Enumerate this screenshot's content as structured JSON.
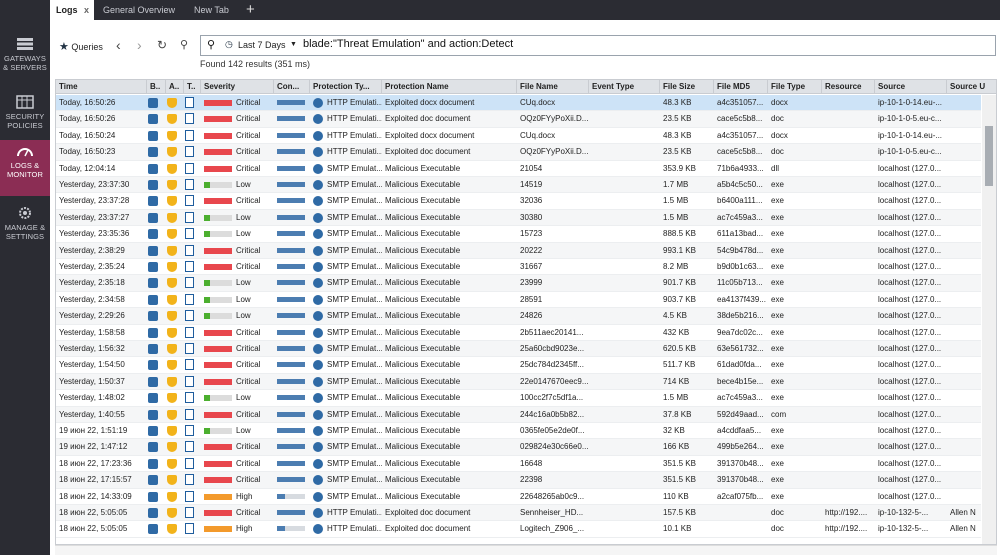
{
  "sidebar": {
    "items": [
      {
        "label_line1": "GATEWAYS",
        "label_line2": "& SERVERS",
        "icon": "gateways-icon",
        "active": false
      },
      {
        "label_line1": "SECURITY",
        "label_line2": "POLICIES",
        "icon": "policies-icon",
        "active": false
      },
      {
        "label_line1": "LOGS &",
        "label_line2": "MONITOR",
        "icon": "monitor-icon",
        "active": true
      },
      {
        "label_line1": "MANAGE &",
        "label_line2": "SETTINGS",
        "icon": "settings-icon",
        "active": false
      }
    ]
  },
  "tabs": {
    "items": [
      "Logs",
      "General Overview",
      "New Tab"
    ],
    "close": "x",
    "plus": "+"
  },
  "toolbar": {
    "queries_label": "Queries",
    "time_filter": "Last 7 Days",
    "query_text": "blade:\"Threat Emulation\" and action:Detect",
    "found_text": "Found 142 results (351 ms)"
  },
  "grid": {
    "columns": [
      "Time",
      "B..",
      "A..",
      "T..",
      "Severity",
      "Con...",
      "Protection Ty...",
      "Protection Name",
      "File Name",
      "Event Type",
      "File Size",
      "File MD5",
      "File Type",
      "Resource",
      "Source",
      "Source U"
    ],
    "rows": [
      [
        "Today, 16:50:26",
        "Critical",
        "HTTP Emulati...",
        "Exploited docx document",
        "CUq.docx",
        "",
        "48.3 KB",
        "a4c351057...",
        "docx",
        "",
        "ip-10-1-0-14.eu-...",
        ""
      ],
      [
        "Today, 16:50:26",
        "Critical",
        "HTTP Emulati...",
        "Exploited doc document",
        "OQz0FYyPoXii.D...",
        "",
        "23.5 KB",
        "cace5c5b8...",
        "doc",
        "",
        "ip-10-1-0-5.eu-c...",
        ""
      ],
      [
        "Today, 16:50:24",
        "Critical",
        "HTTP Emulati...",
        "Exploited docx document",
        "CUq.docx",
        "",
        "48.3 KB",
        "a4c351057...",
        "docx",
        "",
        "ip-10-1-0-14.eu-...",
        ""
      ],
      [
        "Today, 16:50:23",
        "Critical",
        "HTTP Emulati...",
        "Exploited doc document",
        "OQz0FYyPoXii.D...",
        "",
        "23.5 KB",
        "cace5c5b8...",
        "doc",
        "",
        "ip-10-1-0-5.eu-c...",
        ""
      ],
      [
        "Today, 12:04:14",
        "Critical",
        "SMTP Emulat...",
        "Malicious Executable",
        "21054",
        "",
        "353.9 KB",
        "71b6a4933...",
        "dll",
        "",
        "localhost (127.0...",
        ""
      ],
      [
        "Yesterday, 23:37:30",
        "Low",
        "SMTP Emulat...",
        "Malicious Executable",
        "14519",
        "",
        "1.7 MB",
        "a5b4c5c50...",
        "exe",
        "",
        "localhost (127.0...",
        ""
      ],
      [
        "Yesterday, 23:37:28",
        "Critical",
        "SMTP Emulat...",
        "Malicious Executable",
        "32036",
        "",
        "1.5 MB",
        "b6400a111...",
        "exe",
        "",
        "localhost (127.0...",
        ""
      ],
      [
        "Yesterday, 23:37:27",
        "Low",
        "SMTP Emulat...",
        "Malicious Executable",
        "30380",
        "",
        "1.5 MB",
        "ac7c459a3...",
        "exe",
        "",
        "localhost (127.0...",
        ""
      ],
      [
        "Yesterday, 23:35:36",
        "Low",
        "SMTP Emulat...",
        "Malicious Executable",
        "15723",
        "",
        "888.5 KB",
        "611a13bad...",
        "exe",
        "",
        "localhost (127.0...",
        ""
      ],
      [
        "Yesterday, 2:38:29",
        "Critical",
        "SMTP Emulat...",
        "Malicious Executable",
        "20222",
        "",
        "993.1 KB",
        "54c9b478d...",
        "exe",
        "",
        "localhost (127.0...",
        ""
      ],
      [
        "Yesterday, 2:35:24",
        "Critical",
        "SMTP Emulat...",
        "Malicious Executable",
        "31667",
        "",
        "8.2 MB",
        "b9d0b1c63...",
        "exe",
        "",
        "localhost (127.0...",
        ""
      ],
      [
        "Yesterday, 2:35:18",
        "Low",
        "SMTP Emulat...",
        "Malicious Executable",
        "23999",
        "",
        "901.7 KB",
        "11c05b713...",
        "exe",
        "",
        "localhost (127.0...",
        ""
      ],
      [
        "Yesterday, 2:34:58",
        "Low",
        "SMTP Emulat...",
        "Malicious Executable",
        "28591",
        "",
        "903.7 KB",
        "ea4137f439...",
        "exe",
        "",
        "localhost (127.0...",
        ""
      ],
      [
        "Yesterday, 2:29:26",
        "Low",
        "SMTP Emulat...",
        "Malicious Executable",
        "24826",
        "",
        "4.5 KB",
        "38de5b216...",
        "exe",
        "",
        "localhost (127.0...",
        ""
      ],
      [
        "Yesterday, 1:58:58",
        "Critical",
        "SMTP Emulat...",
        "Malicious Executable",
        "2b511aec20141...",
        "",
        "432 KB",
        "9ea7dc02c...",
        "exe",
        "",
        "localhost (127.0...",
        ""
      ],
      [
        "Yesterday, 1:56:32",
        "Critical",
        "SMTP Emulat...",
        "Malicious Executable",
        "25a60cbd9023e...",
        "",
        "620.5 KB",
        "63e561732...",
        "exe",
        "",
        "localhost (127.0...",
        ""
      ],
      [
        "Yesterday, 1:54:50",
        "Critical",
        "SMTP Emulat...",
        "Malicious Executable",
        "25dc784d2345ff...",
        "",
        "511.7 KB",
        "61dad0fda...",
        "exe",
        "",
        "localhost (127.0...",
        ""
      ],
      [
        "Yesterday, 1:50:37",
        "Critical",
        "SMTP Emulat...",
        "Malicious Executable",
        "22e0147670eec9...",
        "",
        "714 KB",
        "bece4b15e...",
        "exe",
        "",
        "localhost (127.0...",
        ""
      ],
      [
        "Yesterday, 1:48:02",
        "Low",
        "SMTP Emulat...",
        "Malicious Executable",
        "100cc2f7c5df1a...",
        "",
        "1.5 MB",
        "ac7c459a3...",
        "exe",
        "",
        "localhost (127.0...",
        ""
      ],
      [
        "Yesterday, 1:40:55",
        "Critical",
        "SMTP Emulat...",
        "Malicious Executable",
        "244c16a0b5b82...",
        "",
        "37.8 KB",
        "592d49aad...",
        "com",
        "",
        "localhost (127.0...",
        ""
      ],
      [
        "19 июн 22, 1:51:19",
        "Low",
        "SMTP Emulat...",
        "Malicious Executable",
        "0365fe05e2de0f...",
        "",
        "32 KB",
        "a4cddfaa5...",
        "exe",
        "",
        "localhost (127.0...",
        ""
      ],
      [
        "19 июн 22, 1:47:12",
        "Critical",
        "SMTP Emulat...",
        "Malicious Executable",
        "029824e30c66e0...",
        "",
        "166 KB",
        "499b5e264...",
        "exe",
        "",
        "localhost (127.0...",
        ""
      ],
      [
        "18 июн 22, 17:23:36",
        "Critical",
        "SMTP Emulat...",
        "Malicious Executable",
        "16648",
        "",
        "351.5 KB",
        "391370b48...",
        "exe",
        "",
        "localhost (127.0...",
        ""
      ],
      [
        "18 июн 22, 17:15:57",
        "Critical",
        "SMTP Emulat...",
        "Malicious Executable",
        "22398",
        "",
        "351.5 KB",
        "391370b48...",
        "exe",
        "",
        "localhost (127.0...",
        ""
      ],
      [
        "18 июн 22, 14:33:09",
        "High",
        "SMTP Emulat...",
        "Malicious Executable",
        "22648265ab0c9...",
        "",
        "110 KB",
        "a2caf075fb...",
        "exe",
        "",
        "localhost (127.0...",
        ""
      ],
      [
        "18 июн 22, 5:05:05",
        "Critical",
        "HTTP Emulati...",
        "Exploited doc document",
        "Sennheiser_HD...",
        "",
        "157.5 KB",
        "",
        "doc",
        "http://192....",
        "ip-10-132-5-...",
        "Allen N"
      ],
      [
        "18 июн 22, 5:05:05",
        "High",
        "HTTP Emulati...",
        "Exploited doc document",
        "Logitech_Z906_...",
        "",
        "10.1 KB",
        "",
        "doc",
        "http://192....",
        "ip-10-132-5-...",
        "Allen N"
      ]
    ],
    "severity_colors": {
      "Critical": "#e8474d",
      "High": "#f39a2c",
      "Low": "#4caf2f"
    },
    "confidence_levels": {
      "Critical": 1.0,
      "High": 0.3,
      "Low": 1.0
    }
  }
}
